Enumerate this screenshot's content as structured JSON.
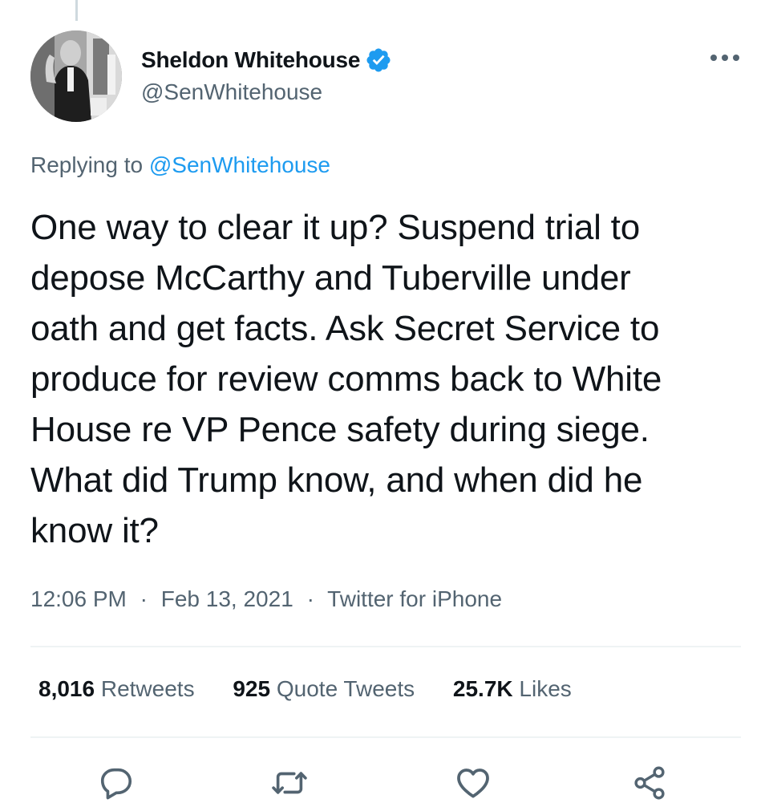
{
  "author": {
    "name": "Sheldon Whitehouse",
    "handle": "@SenWhitehouse",
    "verified": true
  },
  "reply": {
    "prefix": "Replying to",
    "mention": "@SenWhitehouse"
  },
  "tweet": {
    "lines": [
      "One way to clear it up? Suspend trial to",
      "depose McCarthy and Tuberville under",
      "oath and get facts. Ask Secret Service to",
      "produce for review comms back to White",
      "House re VP Pence safety during siege.",
      "What did Trump know, and when did he",
      "know it?"
    ]
  },
  "meta": {
    "time": "12:06 PM",
    "date": "Feb 13, 2021",
    "source": "Twitter for iPhone",
    "separator": "·"
  },
  "stats": {
    "retweets": {
      "count": "8,016",
      "label": "Retweets"
    },
    "quotes": {
      "count": "925",
      "label": "Quote Tweets"
    },
    "likes": {
      "count": "25.7K",
      "label": "Likes"
    }
  },
  "icons": {
    "verified": "verified-badge-icon",
    "more": "more-dots-icon",
    "reply": "reply-icon",
    "retweet": "retweet-icon",
    "like": "heart-icon",
    "share": "share-icon"
  },
  "colors": {
    "accent": "#1d9bf0",
    "text": "#0f1419",
    "secondary": "#536471",
    "divider": "#eff3f4"
  }
}
